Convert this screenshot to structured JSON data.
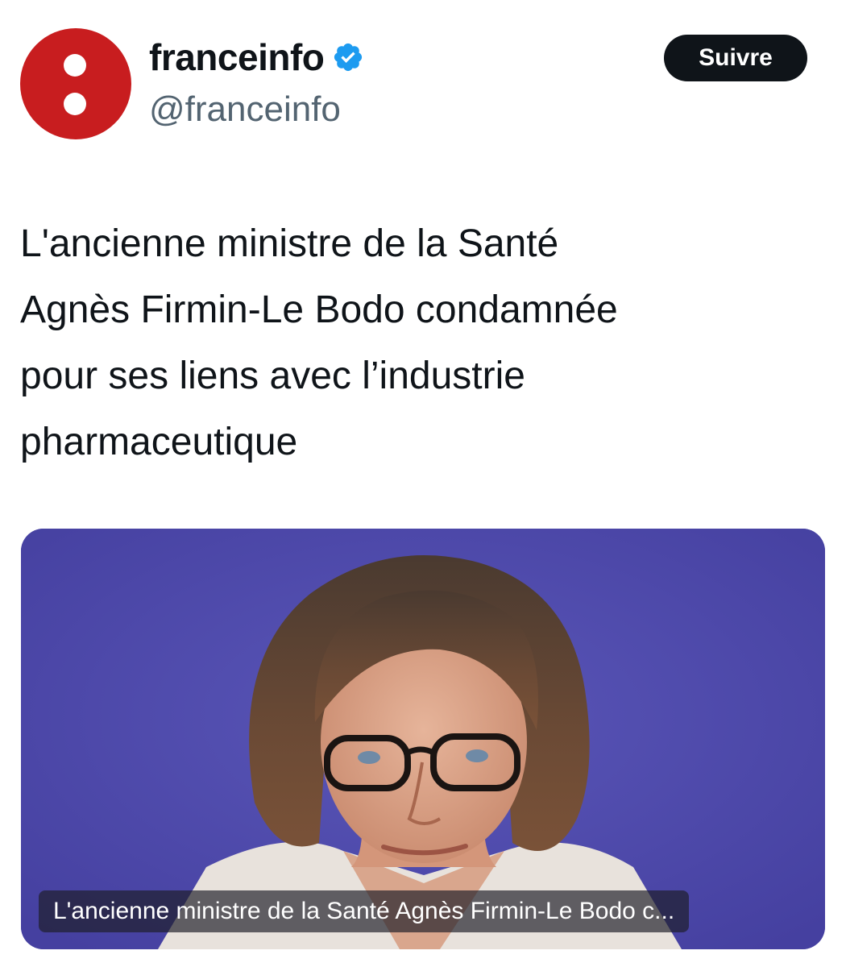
{
  "account": {
    "display_name": "franceinfo",
    "handle": "@franceinfo",
    "verified_icon": "verified-badge-icon",
    "avatar_icon": "franceinfo-logo-icon",
    "avatar_color": "#c81d1f"
  },
  "actions": {
    "follow_label": "Suivre"
  },
  "tweet": {
    "text_lines": [
      "L'ancienne ministre de la Santé",
      "Agnès Firmin-Le Bodo condamnée",
      "pour ses liens avec l’industrie",
      "pharmaceutique"
    ]
  },
  "media": {
    "caption": "L'ancienne ministre de la Santé Agnès Firmin-Le Bodo c...",
    "background_color": "#4d49a8"
  },
  "colors": {
    "verified_blue": "#1d9bf0",
    "text_primary": "#0f1419",
    "text_secondary": "#536471"
  }
}
